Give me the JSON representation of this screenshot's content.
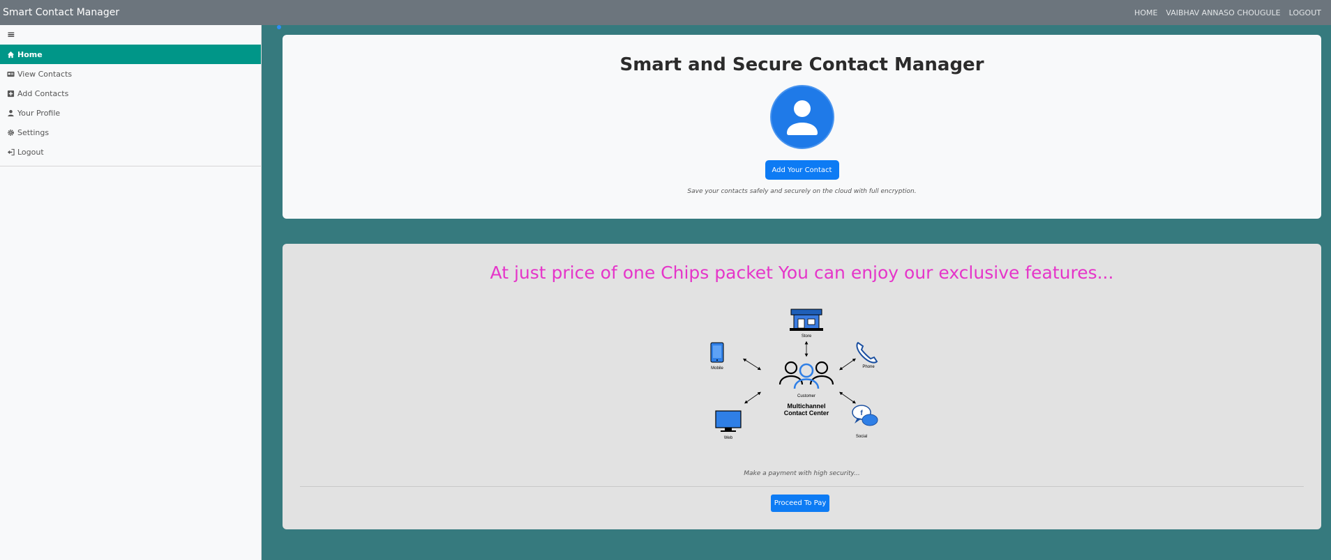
{
  "topbar": {
    "brand": "Smart Contact Manager",
    "nav": [
      "HOME",
      "VAIBHAV ANNASO CHOUGULE",
      "LOGOUT"
    ]
  },
  "sidebar": {
    "toggle_icon": "hamburger-icon",
    "items": [
      {
        "label": "Home",
        "icon": "home-icon",
        "active": true
      },
      {
        "label": "View Contacts",
        "icon": "id-card-icon",
        "active": false
      },
      {
        "label": "Add Contacts",
        "icon": "add-contact-icon",
        "active": false
      },
      {
        "label": "Your Profile",
        "icon": "user-icon",
        "active": false
      },
      {
        "label": "Settings",
        "icon": "gear-icon",
        "active": false
      },
      {
        "label": "Logout",
        "icon": "logout-icon",
        "active": false
      }
    ]
  },
  "hero": {
    "title": "Smart and Secure Contact Manager",
    "button": "Add Your Contact",
    "note": "Save your contacts safely and securely on the cloud with full encryption."
  },
  "promo": {
    "title": "At just price of one Chips packet You can enjoy our exclusive features...",
    "diagram": {
      "labels": [
        "Store",
        "Mobile",
        "Phone",
        "Customer",
        "Web",
        "Social"
      ],
      "caption_line1": "Multichannel",
      "caption_line2": "Contact Center"
    },
    "note": "Make a payment with high security...",
    "button": "Proceed To Pay"
  },
  "colors": {
    "background": "#367a7e",
    "topbar": "#6c757d",
    "active_item": "#009688",
    "primary": "#0d7bf4",
    "promo_title": "#e535c9"
  }
}
